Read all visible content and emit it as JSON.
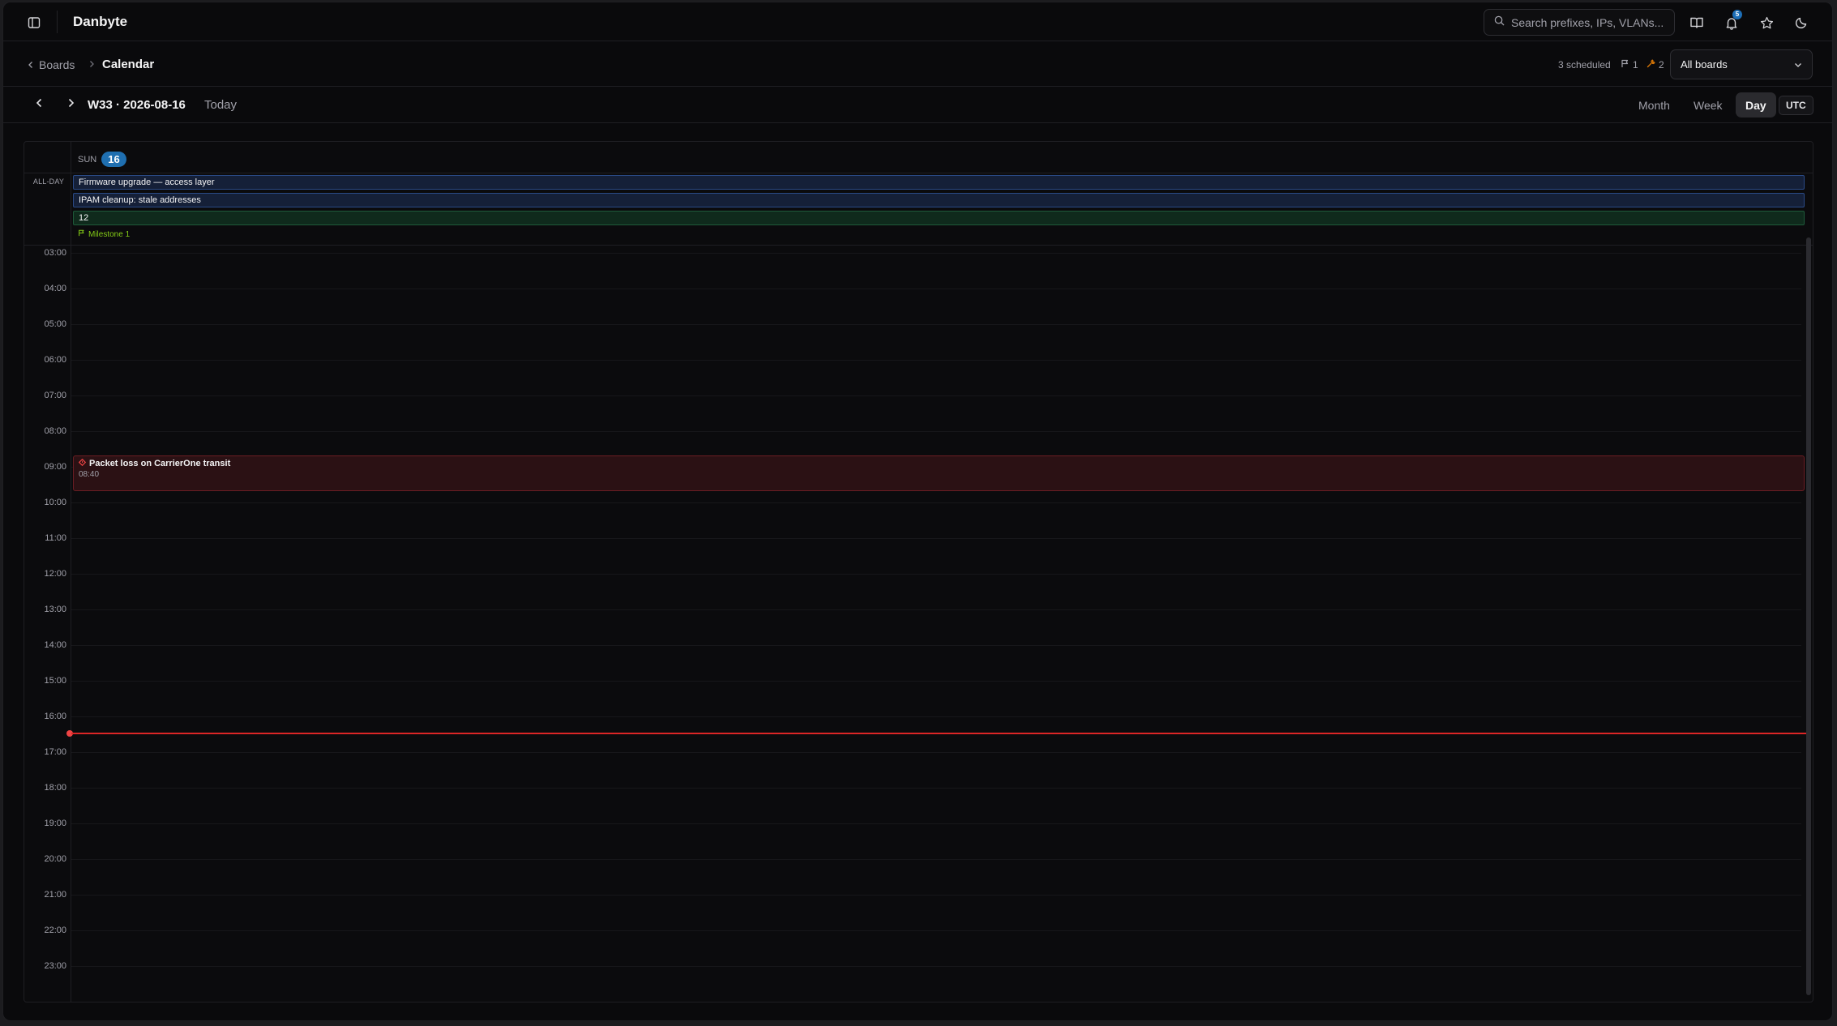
{
  "app": {
    "title": "Danbyte"
  },
  "search": {
    "placeholder": "Search prefixes, IPs, VLANs..."
  },
  "header": {
    "notification_count": "5"
  },
  "breadcrumb": {
    "back_label": "Boards",
    "current": "Calendar"
  },
  "stats": {
    "scheduled": "3 scheduled",
    "milestones": "1",
    "maintenance": "2"
  },
  "board_filter": {
    "selected": "All boards"
  },
  "toolbar": {
    "period": "W33 · 2026-08-16",
    "today": "Today",
    "views": [
      "Month",
      "Week",
      "Day"
    ],
    "active_view": "Day",
    "timezone": "UTC"
  },
  "day": {
    "name": "SUN",
    "number": "16"
  },
  "allday": {
    "label": "ALL-DAY",
    "events": [
      {
        "title": "Firmware upgrade — access layer",
        "color": "blue"
      },
      {
        "title": "IPAM cleanup: stale addresses",
        "color": "blue"
      },
      {
        "title": "12",
        "color": "green"
      }
    ],
    "milestone": "Milestone 1"
  },
  "hours": [
    "03:00",
    "04:00",
    "05:00",
    "06:00",
    "07:00",
    "08:00",
    "09:00",
    "10:00",
    "11:00",
    "12:00",
    "13:00",
    "14:00",
    "15:00",
    "16:00",
    "17:00",
    "18:00",
    "19:00",
    "20:00",
    "21:00",
    "22:00",
    "23:00"
  ],
  "timed_events": [
    {
      "title": "Packet loss on CarrierOne transit",
      "time": "08:40",
      "color": "#dc2626"
    }
  ],
  "colors": {
    "accent": "#1f6fb0",
    "now_line": "#dc2626",
    "milestone": "#84cc16"
  }
}
